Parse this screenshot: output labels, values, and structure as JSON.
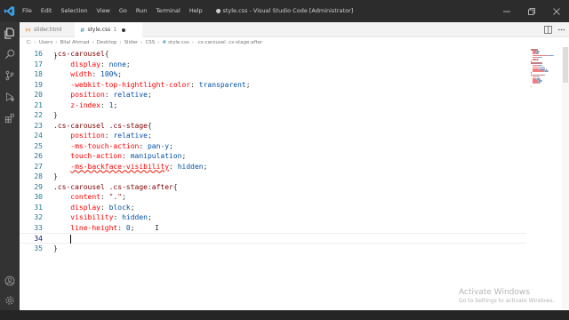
{
  "window": {
    "title": "● style.css - Visual Studio Code [Administrator]"
  },
  "menu": [
    "File",
    "Edit",
    "Selection",
    "View",
    "Go",
    "Run",
    "Terminal",
    "Help"
  ],
  "tabs": [
    {
      "icon": "html-file-icon",
      "label": "slider.html",
      "active": false
    },
    {
      "icon": "css-file-icon",
      "label": "style.css",
      "modified_count": "1",
      "active": true
    }
  ],
  "breadcrumb": {
    "path": [
      "C:",
      "Users",
      "Bilal Ahmad",
      "Desktop",
      "Slider",
      "CSS"
    ],
    "file": "style.css",
    "symbol": ".cs-carousel .cs-stage:after"
  },
  "editor": {
    "lines": [
      {
        "num": "16",
        "tokens": [
          {
            "t": ".cs-carousel",
            "c": "sel"
          },
          {
            "t": "{",
            "c": "brace"
          }
        ]
      },
      {
        "num": "17",
        "tokens": [
          {
            "t": "    ",
            "c": "pun"
          },
          {
            "t": "display",
            "c": "prop"
          },
          {
            "t": ": ",
            "c": "pun"
          },
          {
            "t": "none",
            "c": "val"
          },
          {
            "t": ";",
            "c": "pun"
          }
        ]
      },
      {
        "num": "18",
        "tokens": [
          {
            "t": "    ",
            "c": "pun"
          },
          {
            "t": "width",
            "c": "prop"
          },
          {
            "t": ": ",
            "c": "pun"
          },
          {
            "t": "100%",
            "c": "val"
          },
          {
            "t": ";",
            "c": "pun"
          }
        ]
      },
      {
        "num": "19",
        "tokens": [
          {
            "t": "    ",
            "c": "pun"
          },
          {
            "t": "-webkit-top-hightlight-color",
            "c": "prop"
          },
          {
            "t": ": ",
            "c": "pun"
          },
          {
            "t": "transparent",
            "c": "val"
          },
          {
            "t": ";",
            "c": "pun"
          }
        ]
      },
      {
        "num": "20",
        "tokens": [
          {
            "t": "    ",
            "c": "pun"
          },
          {
            "t": "position",
            "c": "prop"
          },
          {
            "t": ": ",
            "c": "pun"
          },
          {
            "t": "relative",
            "c": "val"
          },
          {
            "t": ";",
            "c": "pun"
          }
        ]
      },
      {
        "num": "21",
        "tokens": [
          {
            "t": "    ",
            "c": "pun"
          },
          {
            "t": "z-index",
            "c": "prop"
          },
          {
            "t": ": ",
            "c": "pun"
          },
          {
            "t": "1",
            "c": "val"
          },
          {
            "t": ";",
            "c": "pun"
          }
        ]
      },
      {
        "num": "22",
        "tokens": [
          {
            "t": "}",
            "c": "brace"
          }
        ]
      },
      {
        "num": "23",
        "tokens": [
          {
            "t": ".cs-carousel .cs-stage",
            "c": "sel"
          },
          {
            "t": "{",
            "c": "brace"
          }
        ]
      },
      {
        "num": "24",
        "tokens": [
          {
            "t": "    ",
            "c": "pun"
          },
          {
            "t": "position",
            "c": "prop"
          },
          {
            "t": ": ",
            "c": "pun"
          },
          {
            "t": "relative",
            "c": "val"
          },
          {
            "t": ";",
            "c": "pun"
          }
        ]
      },
      {
        "num": "25",
        "tokens": [
          {
            "t": "    ",
            "c": "pun"
          },
          {
            "t": "-ms-touch-action",
            "c": "prop"
          },
          {
            "t": ": ",
            "c": "pun"
          },
          {
            "t": "pan-y",
            "c": "val"
          },
          {
            "t": ";",
            "c": "pun"
          }
        ]
      },
      {
        "num": "26",
        "tokens": [
          {
            "t": "    ",
            "c": "pun"
          },
          {
            "t": "touch-action",
            "c": "prop"
          },
          {
            "t": ": ",
            "c": "pun"
          },
          {
            "t": "manipulation",
            "c": "val"
          },
          {
            "t": ";",
            "c": "pun"
          }
        ]
      },
      {
        "num": "27",
        "tokens": [
          {
            "t": "    ",
            "c": "pun"
          },
          {
            "t": "-ms-backface-visibility",
            "c": "prop squiggle"
          },
          {
            "t": ": ",
            "c": "pun"
          },
          {
            "t": "hidden",
            "c": "val"
          },
          {
            "t": ";",
            "c": "pun"
          }
        ]
      },
      {
        "num": "28",
        "tokens": [
          {
            "t": "}",
            "c": "brace"
          }
        ]
      },
      {
        "num": "29",
        "tokens": [
          {
            "t": ".cs-carousel .cs-stage:after",
            "c": "sel"
          },
          {
            "t": "{",
            "c": "brace"
          }
        ]
      },
      {
        "num": "30",
        "tokens": [
          {
            "t": "    ",
            "c": "pun"
          },
          {
            "t": "content",
            "c": "prop"
          },
          {
            "t": ": ",
            "c": "pun"
          },
          {
            "t": "\".\"",
            "c": "str"
          },
          {
            "t": ";",
            "c": "pun"
          }
        ]
      },
      {
        "num": "31",
        "tokens": [
          {
            "t": "    ",
            "c": "pun"
          },
          {
            "t": "display",
            "c": "prop"
          },
          {
            "t": ": ",
            "c": "pun"
          },
          {
            "t": "block",
            "c": "val"
          },
          {
            "t": ";",
            "c": "pun"
          }
        ]
      },
      {
        "num": "32",
        "tokens": [
          {
            "t": "    ",
            "c": "pun"
          },
          {
            "t": "visibility",
            "c": "prop"
          },
          {
            "t": ": ",
            "c": "pun"
          },
          {
            "t": "hidden",
            "c": "val"
          },
          {
            "t": ";",
            "c": "pun"
          }
        ]
      },
      {
        "num": "33",
        "tokens": [
          {
            "t": "    ",
            "c": "pun"
          },
          {
            "t": "line-height",
            "c": "prop"
          },
          {
            "t": ": ",
            "c": "pun"
          },
          {
            "t": "0",
            "c": "val"
          },
          {
            "t": ";",
            "c": "pun"
          }
        ]
      },
      {
        "num": "34",
        "tokens": [
          {
            "t": "    ",
            "c": "pun"
          }
        ],
        "current": true,
        "cursor": true
      },
      {
        "num": "35",
        "tokens": [
          {
            "t": "}",
            "c": "brace"
          }
        ]
      }
    ]
  },
  "watermark": {
    "title": "Activate Windows",
    "subtitle": "Go to Settings to activate Windows."
  },
  "colors": {
    "titlebar": "#2c2c2c",
    "activitybar": "#333333",
    "selector": "#800000",
    "property": "#ff0000",
    "value": "#0451a5",
    "line_number": "#237893"
  }
}
